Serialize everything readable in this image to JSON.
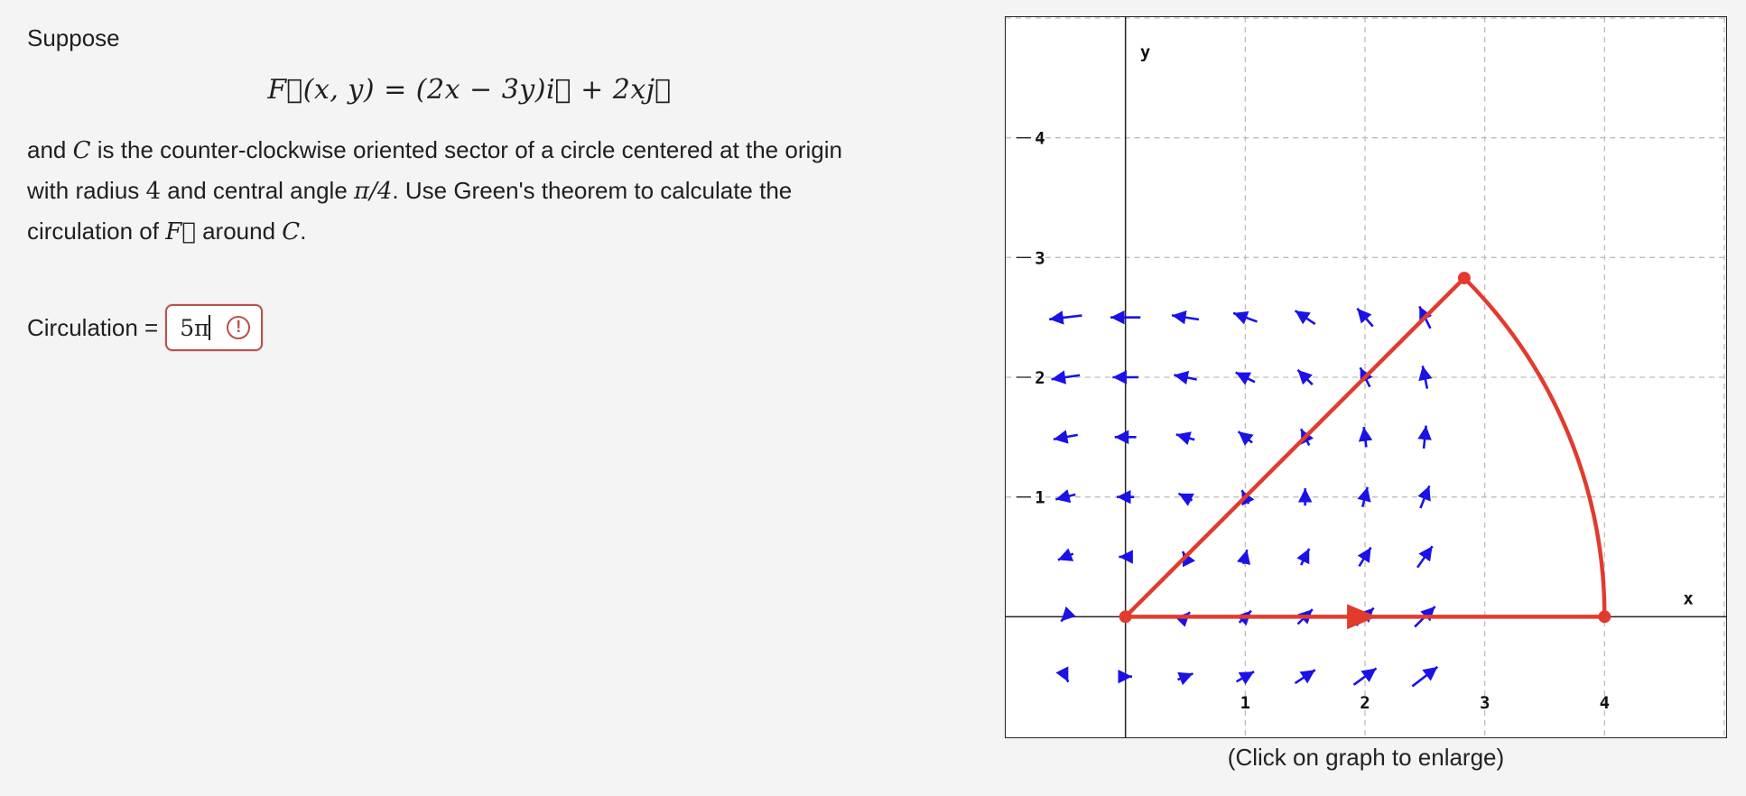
{
  "problem": {
    "intro": "Suppose",
    "formula": "F⃗(x, y) = (2x − 3y)i⃗ + 2xj⃗",
    "line1_a": "and",
    "var_C": "C",
    "line1_b": "is the counter-clockwise oriented sector of a circle centered at the origin",
    "line2_a": "with radius",
    "radius": "4",
    "line2_b": "and central angle",
    "angle": "π/4",
    "line2_c": ". Use Green's theorem to calculate the",
    "line3_a": "circulation of",
    "var_F": "F⃗",
    "line3_b": "around",
    "var_C2": "C",
    "line3_c": "."
  },
  "answer": {
    "label": "Circulation =",
    "value": "5π",
    "status_icon": "alert-circle-icon",
    "status_glyph": "!"
  },
  "graph": {
    "axis_x_label": "x",
    "axis_y_label": "y",
    "x_ticks": [
      "1",
      "2",
      "3",
      "4"
    ],
    "y_ticks": [
      "1",
      "2",
      "3",
      "4"
    ],
    "caption": "(Click on graph to enlarge)",
    "field_color": "#1a12e6",
    "curve_color": "#e23b2e"
  }
}
